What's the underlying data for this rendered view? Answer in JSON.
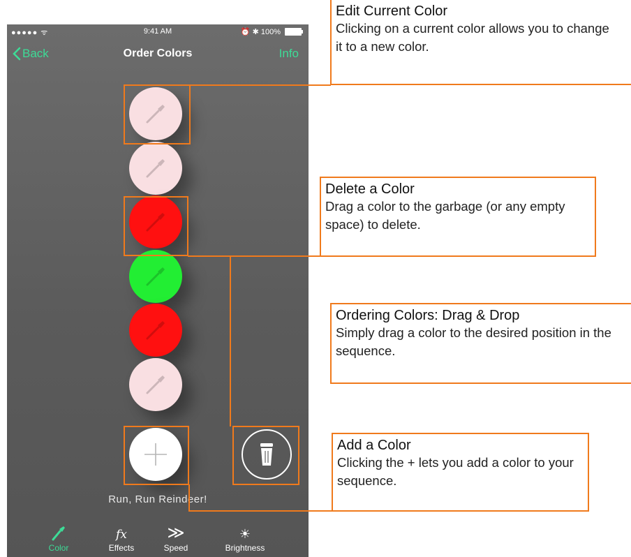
{
  "status": {
    "signal": "●●●●● ᯤ",
    "time": "9:41 AM",
    "battery": "⏰ ✱ 100%"
  },
  "nav": {
    "back": "Back",
    "title": "Order Colors",
    "info": "Info"
  },
  "colors": [
    {
      "name": "pink",
      "hex": "#f9dfe2"
    },
    {
      "name": "pink",
      "hex": "#f9dfe2"
    },
    {
      "name": "red",
      "hex": "#ff1010"
    },
    {
      "name": "green",
      "hex": "#22ee33"
    },
    {
      "name": "red",
      "hex": "#ff1010"
    },
    {
      "name": "pink",
      "hex": "#f9dfe2"
    }
  ],
  "add_button_icon": "plus-icon",
  "trash_icon": "trash-icon",
  "sequence_name": "Run, Run Reindeer!",
  "tabs": [
    {
      "label": "Color",
      "icon": "eyedropper-icon",
      "active": true
    },
    {
      "label": "Effects",
      "icon": "fx-icon",
      "glyph": "fx"
    },
    {
      "label": "Speed",
      "icon": "double-chevron-icon",
      "glyph": "≫"
    },
    {
      "label": "Brightness",
      "icon": "sun-icon",
      "glyph": "☀"
    }
  ],
  "annotations": {
    "edit": {
      "title": "Edit Current Color",
      "body": "Clicking on a current color allows you to change it to a new color."
    },
    "delete": {
      "title": "Delete a Color",
      "body": "Drag a color to the garbage (or any empty space) to delete."
    },
    "order": {
      "title": "Ordering Colors: Drag & Drop",
      "body": "Simply drag a color to the desired position in the sequence."
    },
    "add": {
      "title": "Add a Color",
      "body": "Clicking the + lets you add a color to your sequence."
    }
  },
  "accent_color": "#3ddc97",
  "annotation_color": "#f07a1c"
}
